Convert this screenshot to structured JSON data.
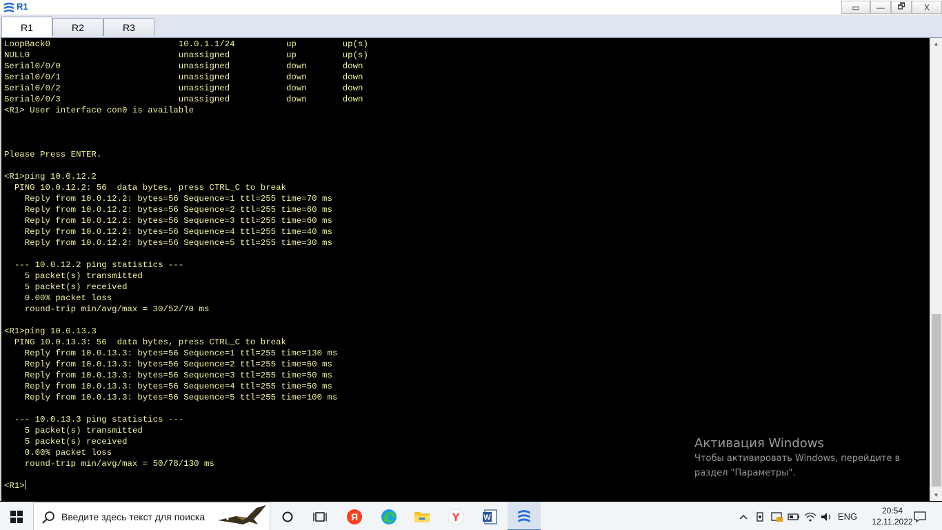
{
  "window": {
    "title": "R1"
  },
  "title_buttons": {
    "restore_alt": "▭",
    "minimize": "—",
    "maximize": "🗗",
    "close": "X"
  },
  "tabs": [
    {
      "label": "R1",
      "active": true
    },
    {
      "label": "R2",
      "active": false
    },
    {
      "label": "R3",
      "active": false
    }
  ],
  "terminal": {
    "text_color": "#f2f2a0",
    "lines": [
      "LoopBack0                         10.0.1.1/24          up         up(s)",
      "NULL0                             unassigned           up         up(s)",
      "Serial0/0/0                       unassigned           down       down",
      "Serial0/0/1                       unassigned           down       down",
      "Serial0/0/2                       unassigned           down       down",
      "Serial0/0/3                       unassigned           down       down",
      "<R1> User interface con0 is available",
      "",
      "",
      "",
      "Please Press ENTER.",
      "",
      "<R1>ping 10.0.12.2",
      "  PING 10.0.12.2: 56  data bytes, press CTRL_C to break",
      "    Reply from 10.0.12.2: bytes=56 Sequence=1 ttl=255 time=70 ms",
      "    Reply from 10.0.12.2: bytes=56 Sequence=2 ttl=255 time=60 ms",
      "    Reply from 10.0.12.2: bytes=56 Sequence=3 ttl=255 time=60 ms",
      "    Reply from 10.0.12.2: bytes=56 Sequence=4 ttl=255 time=40 ms",
      "    Reply from 10.0.12.2: bytes=56 Sequence=5 ttl=255 time=30 ms",
      "",
      "  --- 10.0.12.2 ping statistics ---",
      "    5 packet(s) transmitted",
      "    5 packet(s) received",
      "    0.00% packet loss",
      "    round-trip min/avg/max = 30/52/70 ms",
      "",
      "<R1>ping 10.0.13.3",
      "  PING 10.0.13.3: 56  data bytes, press CTRL_C to break",
      "    Reply from 10.0.13.3: bytes=56 Sequence=1 ttl=255 time=130 ms",
      "    Reply from 10.0.13.3: bytes=56 Sequence=2 ttl=255 time=60 ms",
      "    Reply from 10.0.13.3: bytes=56 Sequence=3 ttl=255 time=50 ms",
      "    Reply from 10.0.13.3: bytes=56 Sequence=4 ttl=255 time=50 ms",
      "    Reply from 10.0.13.3: bytes=56 Sequence=5 ttl=255 time=100 ms",
      "",
      "  --- 10.0.13.3 ping statistics ---",
      "    5 packet(s) transmitted",
      "    5 packet(s) received",
      "    0.00% packet loss",
      "    round-trip min/avg/max = 50/78/130 ms",
      "",
      "<R1>"
    ]
  },
  "activation": {
    "title": "Активация Windows",
    "line1": "Чтобы активировать Windows, перейдите в",
    "line2": "раздел \"Параметры\"."
  },
  "taskbar": {
    "search_placeholder": "Введите здесь текст для поиска",
    "apps": [
      "cortana-icon",
      "task-view-icon",
      "yandex-icon",
      "edge-icon",
      "file-explorer-icon",
      "yandex-browser-icon",
      "word-icon",
      "ensp-icon"
    ],
    "tray_language": "ENG",
    "time": "20:54",
    "date": "12.11.2022"
  }
}
